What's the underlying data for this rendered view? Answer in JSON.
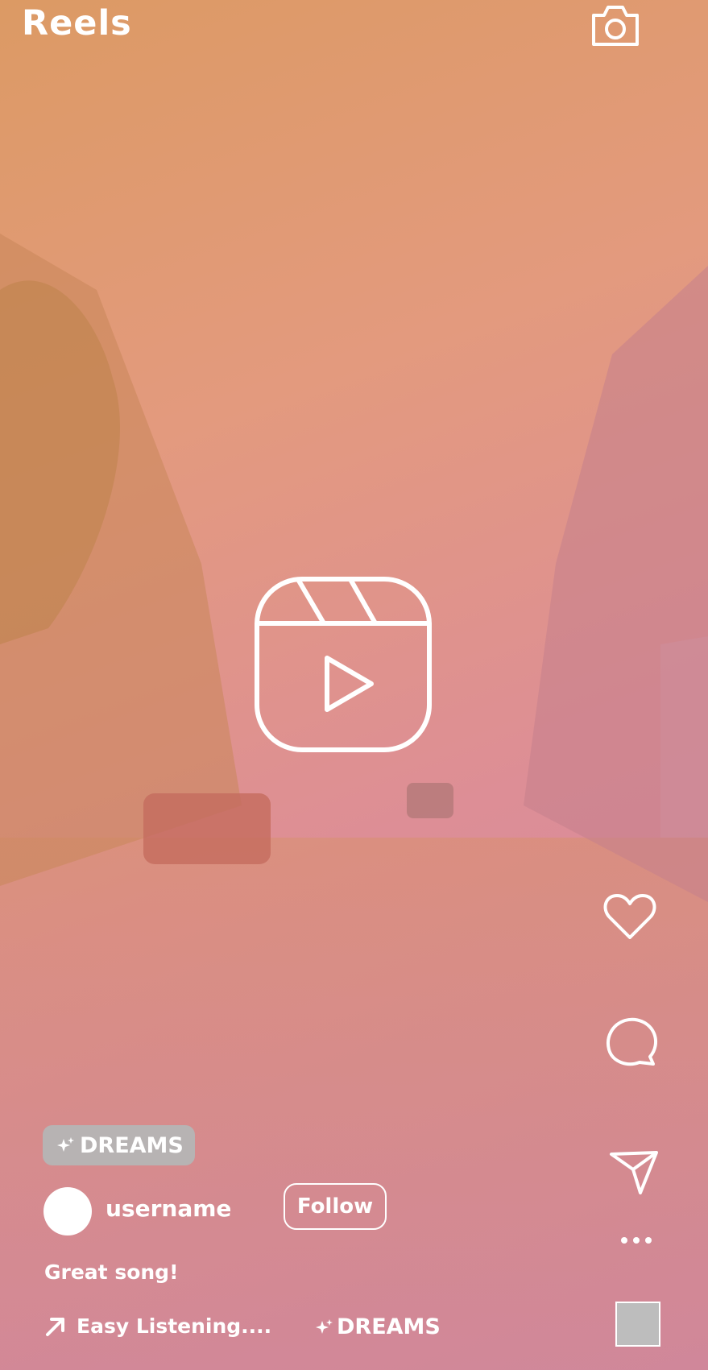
{
  "header": {
    "title": "Reels",
    "camera_icon": "camera-icon"
  },
  "center": {
    "icon": "reels-play-icon"
  },
  "actions": {
    "like_icon": "heart-icon",
    "comment_icon": "comment-icon",
    "share_icon": "paper-plane-icon",
    "more_icon": "more-horizontal-icon"
  },
  "post": {
    "effect_tag": "DREAMS",
    "username": "username",
    "follow_label": "Follow",
    "caption": "Great song!",
    "audio_label": "Easy Listening....",
    "effect_label": "DREAMS"
  },
  "colors": {
    "gradient_start": "#dc9a64",
    "gradient_end": "#cf86a6",
    "tag_background": "#b7b3b3",
    "thumbnail": "#bdbdbd"
  }
}
